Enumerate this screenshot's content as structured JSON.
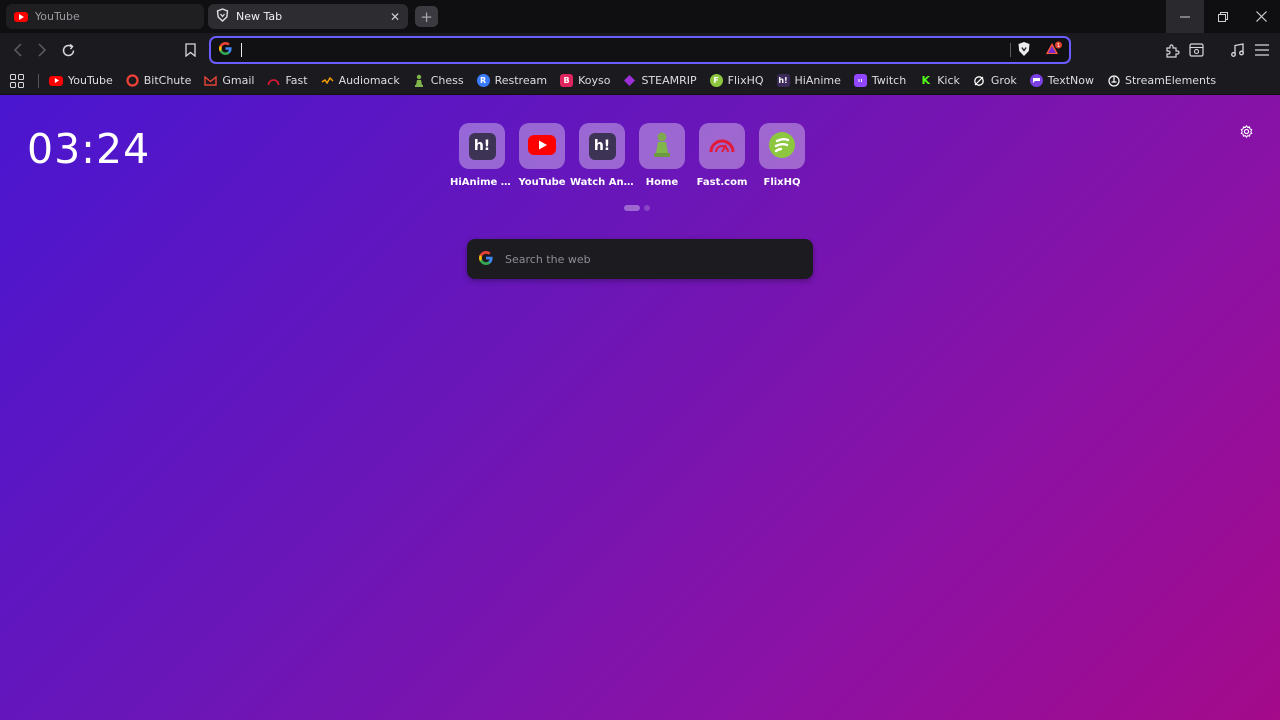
{
  "tabs": [
    {
      "title": "YouTube",
      "active": false,
      "icon": "youtube-icon"
    },
    {
      "title": "New Tab",
      "active": true,
      "icon": "brave-shield-icon"
    }
  ],
  "window_controls": [
    "minimize-icon",
    "restore-icon",
    "close-icon"
  ],
  "omnibox": {
    "value": "",
    "engine_icon": "google-icon"
  },
  "bookmarks": [
    {
      "label": "YouTube",
      "icon": "youtube-icon",
      "color": "#ff0000"
    },
    {
      "label": "BitChute",
      "icon": "bitchute-icon",
      "color": "#ef4137"
    },
    {
      "label": "Gmail",
      "icon": "gmail-icon",
      "color": "#ea4335"
    },
    {
      "label": "Fast",
      "icon": "fast-icon",
      "color": "#e31937"
    },
    {
      "label": "Audiomack",
      "icon": "audiomack-icon",
      "color": "#ffa200"
    },
    {
      "label": "Chess",
      "icon": "chess-icon",
      "color": "#81b64c"
    },
    {
      "label": "Restream",
      "icon": "restream-icon",
      "color": "#3a7bfd"
    },
    {
      "label": "Koyso",
      "icon": "koyso-icon",
      "color": "#e0245e"
    },
    {
      "label": "STEAMRIP",
      "icon": "steamrip-icon",
      "color": "#9b30d9"
    },
    {
      "label": "FlixHQ",
      "icon": "flixhq-icon",
      "color": "#8dc63f"
    },
    {
      "label": "HiAnime",
      "icon": "hianime-icon",
      "color": "#3b2a5a"
    },
    {
      "label": "Twitch",
      "icon": "twitch-icon",
      "color": "#9146ff"
    },
    {
      "label": "Kick",
      "icon": "kick-icon",
      "color": "#53fc18"
    },
    {
      "label": "Grok",
      "icon": "grok-icon",
      "color": "#ffffff"
    },
    {
      "label": "TextNow",
      "icon": "textnow-icon",
      "color": "#7b3fe4"
    },
    {
      "label": "StreamElements",
      "icon": "streamelements-icon",
      "color": "#ffffff"
    }
  ],
  "ntp": {
    "clock": "03:24",
    "search_placeholder": "Search the web",
    "top_sites": [
      {
        "label": "HiAnime Fr...",
        "icon": "hianime-icon"
      },
      {
        "label": "YouTube",
        "icon": "youtube-icon"
      },
      {
        "label": "Watch Ani...",
        "icon": "hianime-icon"
      },
      {
        "label": "Home",
        "icon": "chess-pawn-icon"
      },
      {
        "label": "Fast.com",
        "icon": "speedometer-icon"
      },
      {
        "label": "FlixHQ",
        "icon": "flixhq-icon"
      }
    ]
  },
  "colors": {
    "accent": "#6b5cff",
    "gradient_start": "#4a16d0",
    "gradient_end": "#a40a8a"
  }
}
